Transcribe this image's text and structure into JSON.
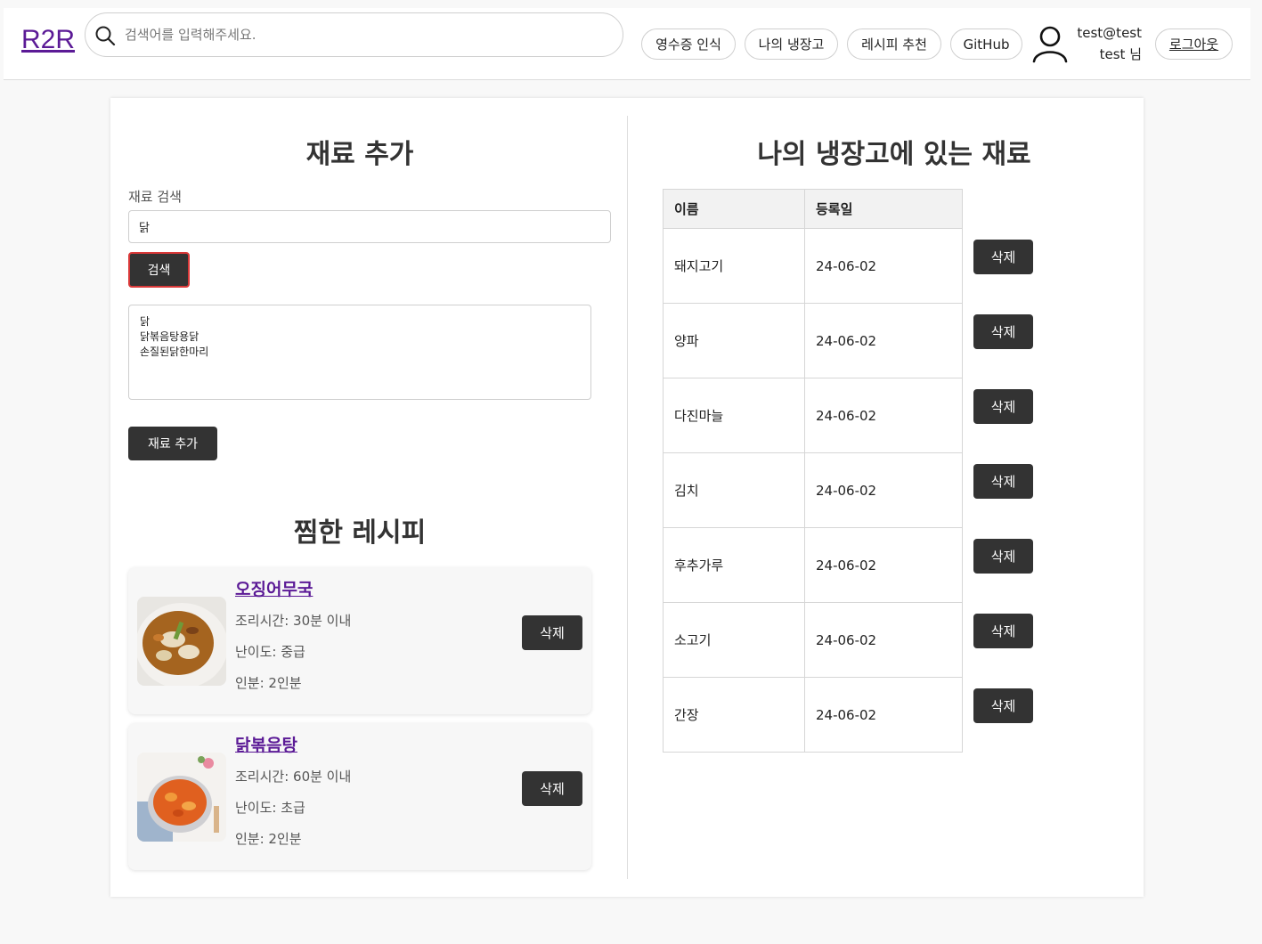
{
  "header": {
    "logo": "R2R",
    "search_placeholder": "검색어를 입력해주세요.",
    "nav": [
      "영수증 인식",
      "나의 냉장고",
      "레시피 추천",
      "GitHub"
    ],
    "user_email": "test@test",
    "user_name": "test 님",
    "logout": "로그아웃"
  },
  "add_ingredient": {
    "title": "재료 추가",
    "search_label": "재료 검색",
    "search_value": "닭",
    "search_button": "검색",
    "results": [
      "닭",
      "닭볶음탕용닭",
      "손질된닭한마리"
    ],
    "add_button": "재료 추가"
  },
  "favorites": {
    "title": "찜한 레시피",
    "recipes": [
      {
        "name": "오징어무국",
        "time": "조리시간: 30분 이내",
        "level": "난이도: 중급",
        "servings": "인분: 2인분",
        "delete": "삭제"
      },
      {
        "name": "닭볶음탕",
        "time": "조리시간: 60분 이내",
        "level": "난이도: 초급",
        "servings": "인분: 2인분",
        "delete": "삭제"
      }
    ]
  },
  "fridge": {
    "title": "나의 냉장고에 있는 재료",
    "headers": [
      "이름",
      "등록일"
    ],
    "rows": [
      {
        "name": "돼지고기",
        "date": "24-06-02"
      },
      {
        "name": "양파",
        "date": "24-06-02"
      },
      {
        "name": "다진마늘",
        "date": "24-06-02"
      },
      {
        "name": "김치",
        "date": "24-06-02"
      },
      {
        "name": "후추가루",
        "date": "24-06-02"
      },
      {
        "name": "소고기",
        "date": "24-06-02"
      },
      {
        "name": "간장",
        "date": "24-06-02"
      }
    ],
    "delete_label": "삭제"
  },
  "colors": {
    "accent_link": "#5b1a96",
    "dark_button": "#333333",
    "search_btn_border": "#d93838"
  }
}
